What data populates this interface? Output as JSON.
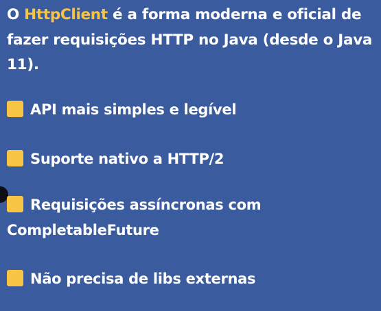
{
  "intro": {
    "prefix": "O ",
    "highlight": "HttpClient",
    "rest": " é a forma moderna e oficial de fazer requisições HTTP no Java (desde o Java 11)."
  },
  "items": [
    {
      "label": "API mais simples e legível"
    },
    {
      "label": "Suporte nativo a HTTP/2"
    },
    {
      "label": "Requisições assíncronas com CompletableFuture"
    },
    {
      "label": "Não precisa de libs externas"
    }
  ],
  "colors": {
    "background": "#3b5b9f",
    "accent": "#f7c443",
    "text": "#ffffff"
  }
}
